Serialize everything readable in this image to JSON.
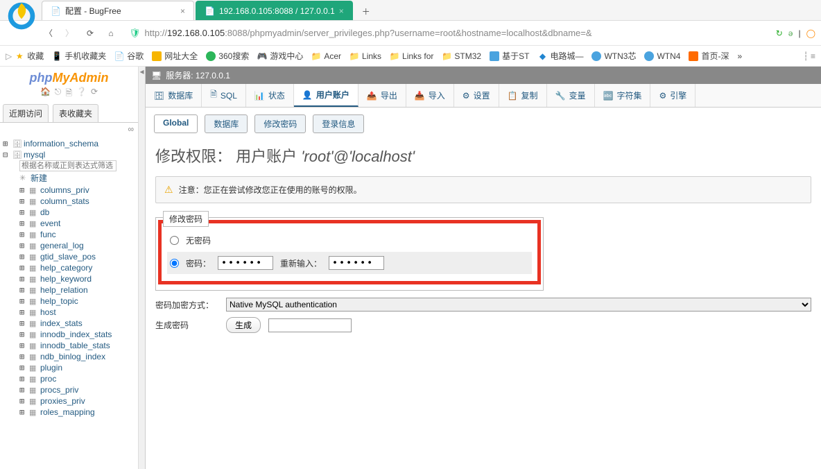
{
  "browser": {
    "tabs": [
      {
        "title": "配置 - BugFree"
      },
      {
        "title": "192.168.0.105:8088 / 127.0.0.1"
      }
    ],
    "url_prefix": "http://",
    "url_host": "192.168.0.105",
    "url_rest": ":8088/phpmyadmin/server_privileges.php?username=root&hostname=localhost&dbname=&"
  },
  "bookmarks": {
    "fav": "收藏",
    "items": [
      "手机收藏夹",
      "谷歌",
      "网址大全",
      "360搜索",
      "游戏中心",
      "Acer",
      "Links",
      "Links for",
      "STM32",
      "基于ST",
      "电路城—",
      "WTN3芯",
      "WTN4",
      "首页-深"
    ]
  },
  "sidebar": {
    "logo1": "php",
    "logo2": "MyAdmin",
    "recent": "近期访问",
    "favorites": "表收藏夹",
    "filter_placeholder": "根据名称或正则表达式筛选",
    "new_item": "新建",
    "dbs": [
      "information_schema",
      "mysql"
    ],
    "tables": [
      "columns_priv",
      "column_stats",
      "db",
      "event",
      "func",
      "general_log",
      "gtid_slave_pos",
      "help_category",
      "help_keyword",
      "help_relation",
      "help_topic",
      "host",
      "index_stats",
      "innodb_index_stats",
      "innodb_table_stats",
      "ndb_binlog_index",
      "plugin",
      "proc",
      "procs_priv",
      "proxies_priv",
      "roles_mapping"
    ]
  },
  "server_label": "服务器: 127.0.0.1",
  "top_tabs": [
    "数据库",
    "SQL",
    "状态",
    "用户账户",
    "导出",
    "导入",
    "设置",
    "复制",
    "变量",
    "字符集",
    "引擎"
  ],
  "sub_tabs": [
    "Global",
    "数据库",
    "修改密码",
    "登录信息"
  ],
  "page": {
    "title_prefix": "修改权限：  用户账户 ",
    "account": "'root'@'localhost'",
    "notice": "注意：您正在尝试修改您正在使用的账号的权限。",
    "legend": "修改密码",
    "no_password": "无密码",
    "password_label": "密码：",
    "reenter_label": "重新输入：",
    "pw_mask": "••••••",
    "hash_label": "密码加密方式：",
    "hash_value": "Native MySQL authentication",
    "gen_label": "生成密码",
    "gen_btn": "生成"
  }
}
